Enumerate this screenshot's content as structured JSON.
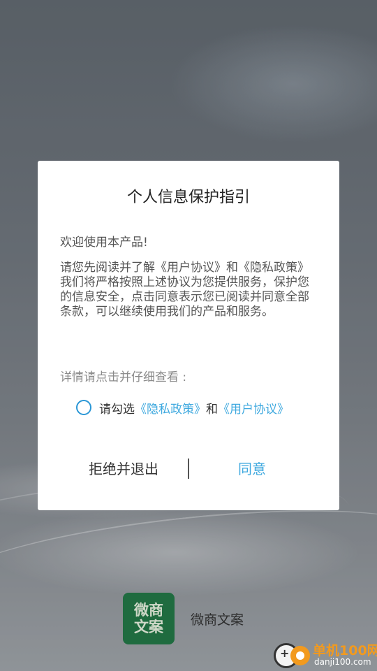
{
  "dialog": {
    "title": "个人信息保护指引",
    "welcome": "欢迎使用本产品!",
    "body": "请您先阅读并了解《用户协议》和《隐私政策》我们将严格按照上述协议为您提供服务，保护您的信息安全，点击同意表示您已阅读并同意全部条款，可以继续使用我们的产品和服务。",
    "detail_hint": "详情请点击并仔细查看 :",
    "agree_prefix": "请勾选",
    "privacy_link": "《隐私政策》",
    "and_text": "和",
    "user_agreement_link": "《用户协议》",
    "reject_label": "拒绝并退出",
    "agree_label": "同意",
    "checkbox_checked": false
  },
  "app": {
    "icon_text_line1": "微商",
    "icon_text_line2": "文案",
    "name": "微商文案"
  },
  "watermark": {
    "title": "单机100网",
    "url": "danji100.com"
  },
  "colors": {
    "accent": "#3fa9df",
    "app_icon_bg": "#1f6b3f",
    "watermark_orange": "#f29a1e"
  }
}
